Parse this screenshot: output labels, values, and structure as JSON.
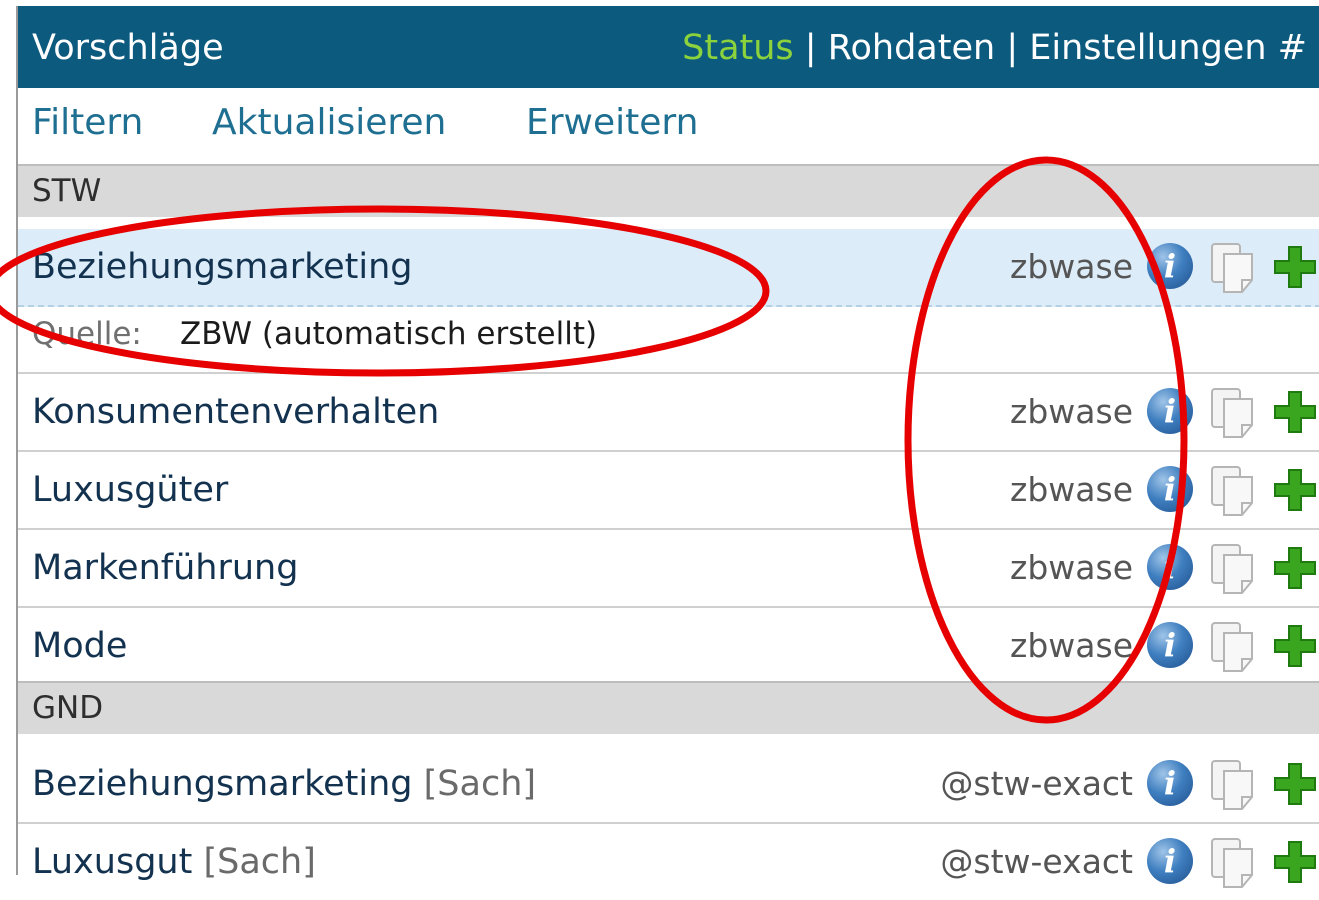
{
  "header": {
    "title": "Vorschläge",
    "links": {
      "status": "Status",
      "sep1": "|",
      "rohdaten": "Rohdaten",
      "sep2": "|",
      "einstellungen": "Einstellungen",
      "hash": "#"
    }
  },
  "toolbar": {
    "filter": "Filtern",
    "refresh": "Aktualisieren",
    "expand": "Erweitern"
  },
  "groups": [
    {
      "name": "STW",
      "items": [
        {
          "label": "Beziehungsmarketing",
          "source": "zbwase",
          "selected": true,
          "detail": {
            "label": "Quelle:",
            "value": "ZBW (automatisch erstellt)"
          }
        },
        {
          "label": "Konsumentenverhalten",
          "source": "zbwase"
        },
        {
          "label": "Luxusgüter",
          "source": "zbwase"
        },
        {
          "label": "Markenführung",
          "source": "zbwase"
        },
        {
          "label": "Mode",
          "source": "zbwase"
        }
      ]
    },
    {
      "name": "GND",
      "items": [
        {
          "label": "Beziehungsmarketing",
          "tag": "[Sach]",
          "source": "@stw-exact"
        },
        {
          "label": "Luxusgut",
          "tag": "[Sach]",
          "source": "@stw-exact"
        }
      ]
    }
  ],
  "icons": {
    "info": "info-icon",
    "copy": "copy-icon",
    "add": "plus-icon",
    "info_glyph": "i"
  },
  "colors": {
    "header_bg": "#0c5a7e",
    "status_link": "#8cd23c",
    "toolbar_link": "#1e6f91",
    "selected_row": "#dcecf9",
    "annotation": "#e60000"
  }
}
